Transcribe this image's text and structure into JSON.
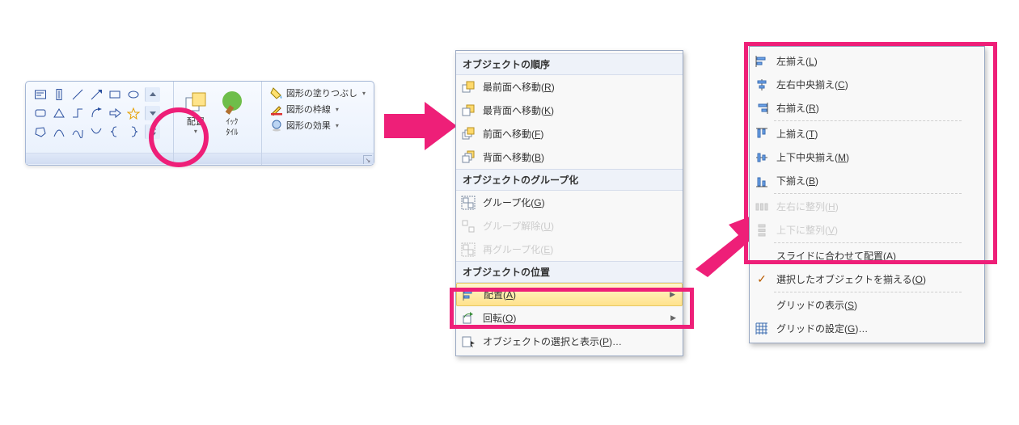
{
  "ribbon": {
    "group_labels": {
      "shapes": "",
      "arrange_btn": "配置",
      "quick_btn": "ｲｯｸ\nﾀｲﾙ",
      "fill": "図形の塗りつぶし",
      "outline": "図形の枠線",
      "effects": "図形の効果"
    }
  },
  "menu": {
    "sections": {
      "order": "オブジェクトの順序",
      "grouping": "オブジェクトのグループ化",
      "position": "オブジェクトの位置"
    },
    "items": {
      "bring_front": "最前面へ移動",
      "bring_front_key": "R",
      "send_back": "最背面へ移動",
      "send_back_key": "K",
      "forward": "前面へ移動",
      "forward_key": "F",
      "backward": "背面へ移動",
      "backward_key": "B",
      "group": "グループ化",
      "group_key": "G",
      "ungroup": "グループ解除",
      "ungroup_key": "U",
      "regroup": "再グループ化",
      "regroup_key": "E",
      "align": "配置",
      "align_key": "A",
      "rotate": "回転",
      "rotate_key": "O",
      "selpane": "オブジェクトの選択と表示",
      "selpane_key": "P",
      "ellipsis": "…"
    }
  },
  "submenu": {
    "left": "左揃え",
    "left_key": "L",
    "center": "左右中央揃え",
    "center_key": "C",
    "right": "右揃え",
    "right_key": "R",
    "top": "上揃え",
    "top_key": "T",
    "middle": "上下中央揃え",
    "middle_key": "M",
    "bottom": "下揃え",
    "bottom_key": "B",
    "dist_h": "左右に整列",
    "dist_h_key": "H",
    "dist_v": "上下に整列",
    "dist_v_key": "V",
    "to_slide": "スライドに合わせて配置",
    "to_slide_key": "A",
    "sel_obj": "選択したオブジェクトを揃える",
    "sel_obj_key": "O",
    "show_grid": "グリッドの表示",
    "show_grid_key": "S",
    "grid_settings": "グリッドの設定",
    "grid_settings_key": "G",
    "ellipsis": "…"
  }
}
